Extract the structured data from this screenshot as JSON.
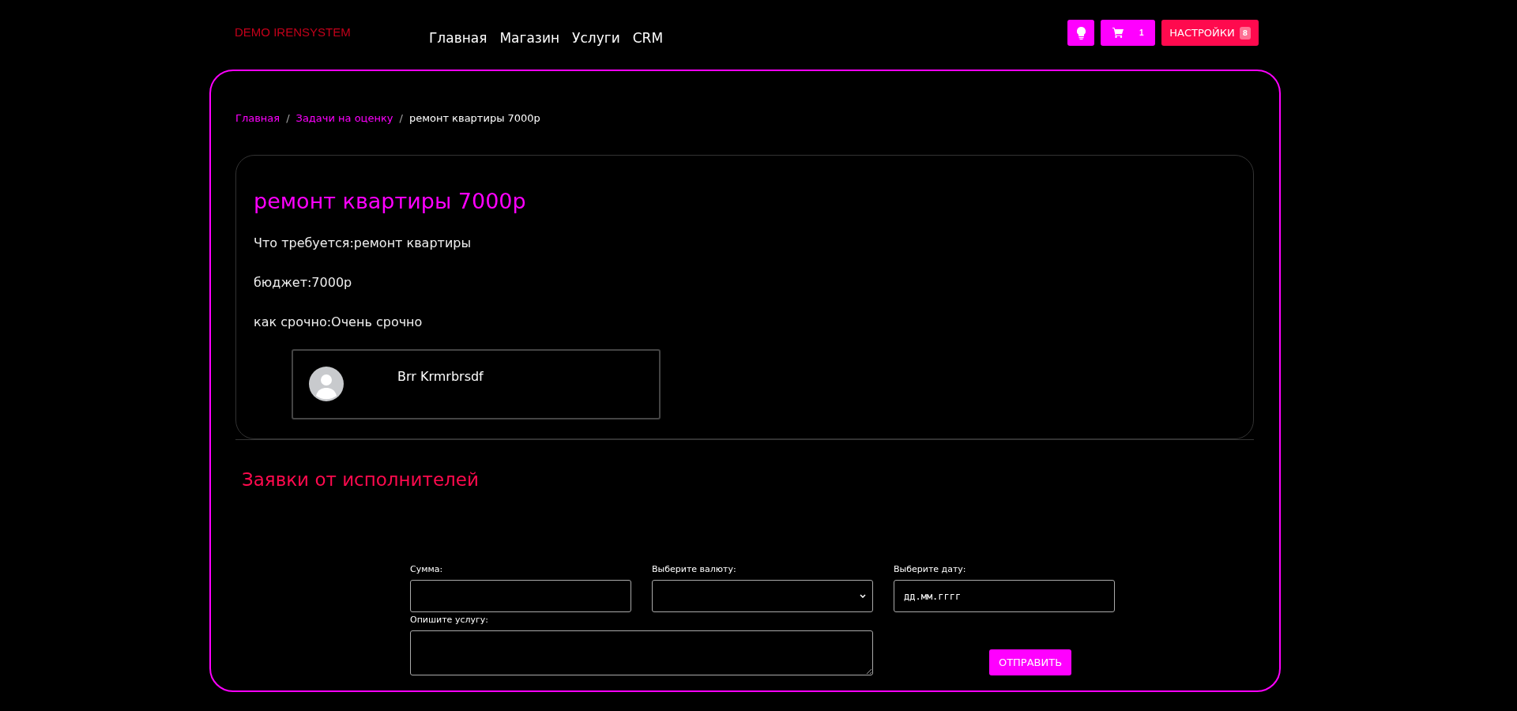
{
  "header": {
    "logo": "DEMO IRENSYSTEM",
    "nav": [
      {
        "label": "Главная"
      },
      {
        "label": "Магазин"
      },
      {
        "label": "Услуги"
      },
      {
        "label": "CRM"
      }
    ],
    "cart_count": "1",
    "settings": {
      "label": "НАСТРОЙКИ",
      "badge": "8"
    }
  },
  "breadcrumb": [
    {
      "label": "Главная",
      "kind": "link"
    },
    {
      "label": "/",
      "kind": "separator"
    },
    {
      "label": "Задачи на оценку",
      "kind": "link"
    },
    {
      "label": "/",
      "kind": "separator"
    },
    {
      "label": "ремонт квартиры 7000р",
      "kind": "current"
    }
  ],
  "task": {
    "title": "ремонт квартиры 7000р",
    "details": [
      "Что требуется:ремонт квартиры",
      "бюджет:7000р",
      "как срочно:Очень срочно"
    ],
    "author": "Brr Krmrbrsdf"
  },
  "bids_heading": "Заявки от исполнителей",
  "form": {
    "fields": [
      {
        "kind": "text",
        "label": "Сумма:"
      },
      {
        "kind": "select",
        "label": "Выберите валюту:"
      },
      {
        "kind": "date",
        "label": "Выберите дату:",
        "placeholder": "дд.мм.гггг"
      }
    ],
    "description_label": "Опишите услугу:",
    "submit": "ОТПРАВИТЬ"
  }
}
